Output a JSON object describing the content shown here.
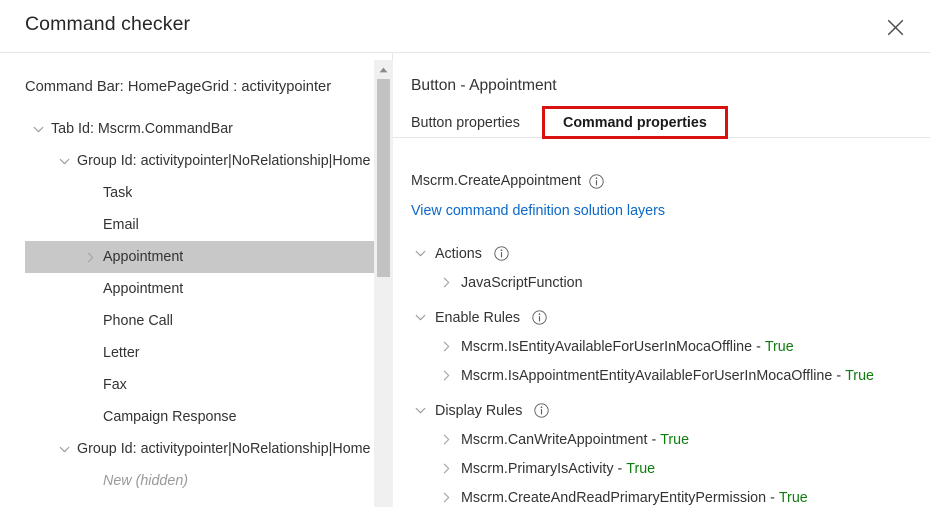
{
  "window": {
    "title": "Command checker",
    "close_label": "Close",
    "close_icon": "close-icon"
  },
  "left": {
    "heading": "Command Bar: HomePageGrid : activitypointer",
    "tree": [
      {
        "label": "Tab Id: Mscrm.CommandBar",
        "indent": 0,
        "chevron": "chevron-down-icon",
        "selected": false,
        "hidden": false
      },
      {
        "label": "Group Id: activitypointer|NoRelationship|Home",
        "indent": 1,
        "chevron": "chevron-down-icon",
        "selected": false,
        "hidden": false
      },
      {
        "label": "Task",
        "indent": 2,
        "chevron": "none",
        "selected": false,
        "hidden": false
      },
      {
        "label": "Email",
        "indent": 2,
        "chevron": "none",
        "selected": false,
        "hidden": false
      },
      {
        "label": "Appointment",
        "indent": 2,
        "chevron": "chevron-right-icon",
        "selected": true,
        "hidden": false
      },
      {
        "label": "Appointment",
        "indent": 2,
        "chevron": "none",
        "selected": false,
        "hidden": false
      },
      {
        "label": "Phone Call",
        "indent": 2,
        "chevron": "none",
        "selected": false,
        "hidden": false
      },
      {
        "label": "Letter",
        "indent": 2,
        "chevron": "none",
        "selected": false,
        "hidden": false
      },
      {
        "label": "Fax",
        "indent": 2,
        "chevron": "none",
        "selected": false,
        "hidden": false
      },
      {
        "label": "Campaign Response",
        "indent": 2,
        "chevron": "none",
        "selected": false,
        "hidden": false
      },
      {
        "label": "Group Id: activitypointer|NoRelationship|Home",
        "indent": 1,
        "chevron": "chevron-down-icon",
        "selected": false,
        "hidden": false
      },
      {
        "label": "New (hidden)",
        "indent": 2,
        "chevron": "none",
        "selected": false,
        "hidden": true
      }
    ],
    "scrollbar": {
      "up_arrow_icon": "caret-up-icon"
    }
  },
  "right": {
    "heading": "Button - Appointment",
    "tabs": [
      {
        "label": "Button properties",
        "active": false,
        "highlighted": false
      },
      {
        "label": "Command properties",
        "active": true,
        "highlighted": true
      }
    ],
    "command_name": "Mscrm.CreateAppointment",
    "command_info_icon": "info-icon",
    "solution_layers_link": "View command definition solution layers",
    "sections": [
      {
        "title": "Actions",
        "info_icon": "info-icon",
        "chevron": "chevron-down-icon",
        "items": [
          {
            "name": "JavaScriptFunction",
            "value": "",
            "chevron": "chevron-right-icon"
          }
        ]
      },
      {
        "title": "Enable Rules",
        "info_icon": "info-icon",
        "chevron": "chevron-down-icon",
        "items": [
          {
            "name": "Mscrm.IsEntityAvailableForUserInMocaOffline",
            "value": "True",
            "chevron": "chevron-right-icon"
          },
          {
            "name": "Mscrm.IsAppointmentEntityAvailableForUserInMocaOffline",
            "value": "True",
            "chevron": "chevron-right-icon"
          }
        ]
      },
      {
        "title": "Display Rules",
        "info_icon": "info-icon",
        "chevron": "chevron-down-icon",
        "items": [
          {
            "name": "Mscrm.CanWriteAppointment",
            "value": "True",
            "chevron": "chevron-right-icon"
          },
          {
            "name": "Mscrm.PrimaryIsActivity",
            "value": "True",
            "chevron": "chevron-right-icon"
          },
          {
            "name": "Mscrm.CreateAndReadPrimaryEntityPermission",
            "value": "True",
            "chevron": "chevron-right-icon"
          }
        ]
      }
    ]
  },
  "colors": {
    "accent_link": "#0a69c8",
    "true_value": "#107c10",
    "highlight_box": "#d81111",
    "selected_row": "#c8c8c8",
    "text": "#333333",
    "divider": "#e6e6e6"
  }
}
